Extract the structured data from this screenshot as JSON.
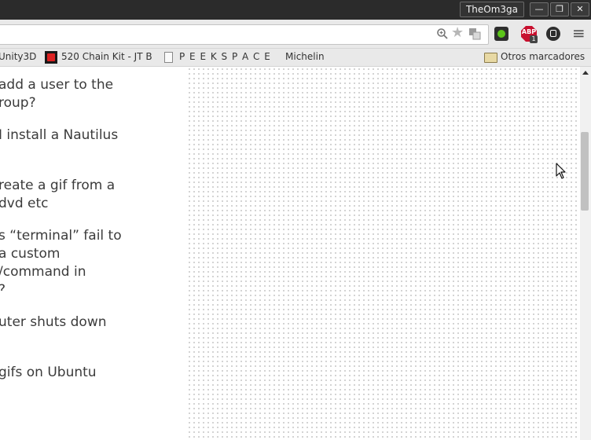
{
  "window": {
    "profile_name": "TheOm3ga",
    "minimize": "—",
    "restore": "❐",
    "close": "✕"
  },
  "toolbar": {
    "zoom_icon": "zoom-icon",
    "star_icon": "star-icon",
    "translate_icon": "translate-icon",
    "ext_green": "green-dot-extension-icon",
    "abp_label": "ABP",
    "abp_count": "1",
    "ext_dark": "dark-extension-icon",
    "menu": "≡"
  },
  "bookmarks": {
    "items": [
      {
        "label": "Unity3D"
      },
      {
        "label": "520 Chain Kit - JT B"
      },
      {
        "label": "P E E K S P A C E"
      },
      {
        "label": "Michelin"
      }
    ],
    "other": "Otros marcadores"
  },
  "questions": [
    {
      "lines": [
        "add a user to the",
        "roup?"
      ]
    },
    {
      "lines": [
        "I install a Nautilus"
      ]
    },
    {
      "lines": [
        "reate a gif from a",
        "dvd etc"
      ]
    },
    {
      "lines": [
        "s “terminal” fail to",
        "a custom",
        "/command in",
        "?"
      ]
    },
    {
      "lines": [
        "uter shuts down"
      ]
    },
    {
      "lines": [
        "gifs on Ubuntu"
      ]
    }
  ],
  "colors": {
    "titlebar": "#2b2b2b",
    "toolbar": "#e9e9e9",
    "link_text": "#3b3b3b",
    "abp_red": "#c8102e",
    "ext_green": "#5cc51a"
  }
}
